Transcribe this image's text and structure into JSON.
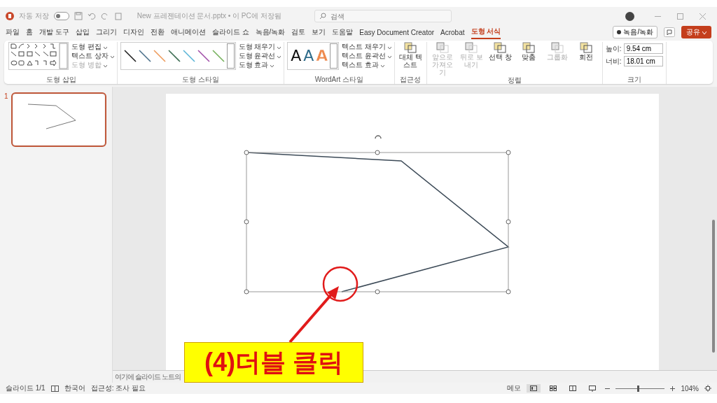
{
  "title_bar": {
    "autosave_label": "자동 저장",
    "autosave_on": false,
    "document_title": "New 프레젠테이션 문서.pptx • 이 PC에 저장됨",
    "search_placeholder": "검색"
  },
  "tabs": [
    {
      "label": "파일",
      "selected": false
    },
    {
      "label": "홈",
      "selected": false
    },
    {
      "label": "개발 도구",
      "selected": false
    },
    {
      "label": "삽입",
      "selected": false
    },
    {
      "label": "그리기",
      "selected": false
    },
    {
      "label": "디자인",
      "selected": false
    },
    {
      "label": "전환",
      "selected": false
    },
    {
      "label": "애니메이션",
      "selected": false
    },
    {
      "label": "슬라이드 쇼",
      "selected": false
    },
    {
      "label": "녹음/녹화",
      "selected": false
    },
    {
      "label": "검토",
      "selected": false
    },
    {
      "label": "보기",
      "selected": false
    },
    {
      "label": "도움말",
      "selected": false
    },
    {
      "label": "Easy Document Creator",
      "selected": false
    },
    {
      "label": "Acrobat",
      "selected": false
    },
    {
      "label": "도형 서식",
      "selected": true
    }
  ],
  "tab_actions": {
    "record": "녹음/녹화",
    "share": "공유"
  },
  "ribbon": {
    "groups": [
      {
        "kind": "insert",
        "label": "도형 삽입",
        "commands": [
          {
            "label": "도형 편집",
            "disabled": false
          },
          {
            "label": "텍스트 상자",
            "disabled": false
          },
          {
            "label": "도형 병합",
            "disabled": true
          }
        ]
      },
      {
        "kind": "styles",
        "label": "도형 스타일",
        "swatches": [
          {
            "color": "#1e1e1e"
          },
          {
            "color": "#4a6f8a"
          },
          {
            "color": "#ed9a5a"
          },
          {
            "color": "#3f6f55"
          },
          {
            "color": "#5ab4d6"
          },
          {
            "color": "#a04fa8"
          },
          {
            "color": "#74b05a"
          }
        ],
        "commands": [
          {
            "label": "도형 채우기",
            "disabled": false
          },
          {
            "label": "도형 윤곽선",
            "disabled": false
          },
          {
            "label": "도형 효과",
            "disabled": false
          }
        ]
      },
      {
        "kind": "wordart",
        "label": "WordArt 스타일",
        "letters": [
          {
            "text": "A",
            "color": "#111111",
            "outlined": false
          },
          {
            "text": "A",
            "color": "#2e6b8a",
            "outlined": false
          },
          {
            "text": "A",
            "color": "#ee8a4e",
            "outlined": true
          }
        ],
        "commands": [
          {
            "label": "텍스트 채우기",
            "disabled": false
          },
          {
            "label": "텍스트 윤곽선",
            "disabled": false
          },
          {
            "label": "텍스트 효과",
            "disabled": false
          }
        ]
      },
      {
        "kind": "accessibility",
        "label": "접근성",
        "commands": [
          {
            "label": "대체 텍스트",
            "disabled": false
          }
        ]
      },
      {
        "kind": "arrange",
        "label": "정렬",
        "commands": [
          {
            "label": "앞으로 가져오기",
            "disabled": true
          },
          {
            "label": "뒤로 보내기",
            "disabled": true
          },
          {
            "label": "선택 창",
            "disabled": false
          },
          {
            "label": "맞춤",
            "disabled": false
          },
          {
            "label": "그룹화",
            "disabled": true
          },
          {
            "label": "회전",
            "disabled": false
          }
        ]
      },
      {
        "kind": "size",
        "label": "크기",
        "fields": [
          {
            "label": "높이:",
            "value": "9.54 cm"
          },
          {
            "label": "너비:",
            "value": "18.01 cm"
          }
        ]
      }
    ]
  },
  "slides": [
    {
      "number": "1",
      "selected": true
    }
  ],
  "editor": {
    "notes_placeholder": "여기에 슬라이드 노트의"
  },
  "status_bar": {
    "slide_info": "슬라이드 1/1",
    "language": "한국어",
    "accessibility": "접근성: 조사 필요",
    "notes_button": "메모",
    "views": [
      {
        "kind": "normal",
        "selected": true
      },
      {
        "kind": "sorter",
        "selected": false
      },
      {
        "kind": "reading",
        "selected": false
      },
      {
        "kind": "show",
        "selected": false
      }
    ],
    "zoom": {
      "level": 0.45,
      "reading": "104%"
    }
  },
  "annotation": {
    "callout": "(4)더블 클릭"
  }
}
